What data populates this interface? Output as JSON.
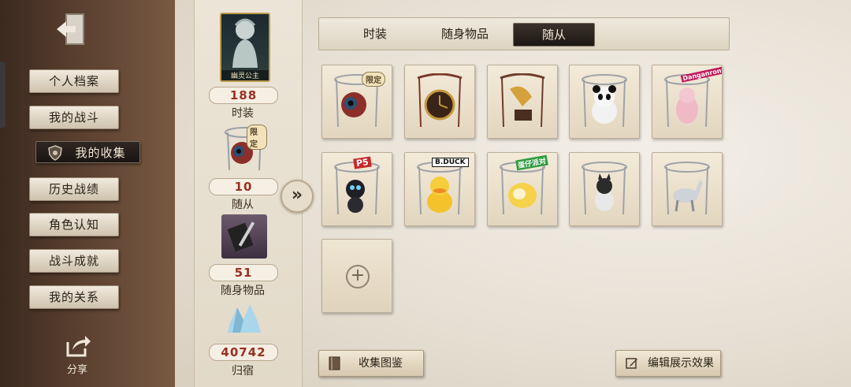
{
  "sidebar": {
    "items": [
      {
        "label": "个人档案"
      },
      {
        "label": "我的战斗"
      },
      {
        "label": "我的收集"
      },
      {
        "label": "历史战绩"
      },
      {
        "label": "角色认知"
      },
      {
        "label": "战斗成就"
      },
      {
        "label": "我的关系"
      }
    ],
    "share_label": "分享"
  },
  "stats": {
    "portrait_caption": "幽灵公主",
    "items": [
      {
        "value": "188",
        "label": "时装"
      },
      {
        "value": "10",
        "label": "随从"
      },
      {
        "value": "51",
        "label": "随身物品"
      },
      {
        "value": "40742",
        "label": "归宿"
      }
    ]
  },
  "tabs": [
    {
      "label": "时装"
    },
    {
      "label": "随身物品"
    },
    {
      "label": "随从"
    }
  ],
  "badges": {
    "limited": "限定",
    "persona": "P5",
    "dangan": "Danganronpa",
    "duck": "B.DUCK",
    "party": "蛋仔派对",
    "limited_stats": "限定"
  },
  "buttons": {
    "gallery": "收集图鉴",
    "edit_display": "编辑展示效果"
  },
  "colors": {
    "accent_red": "#9b2f22",
    "active_tab": "#1d1814",
    "paper": "#ece5d7"
  }
}
